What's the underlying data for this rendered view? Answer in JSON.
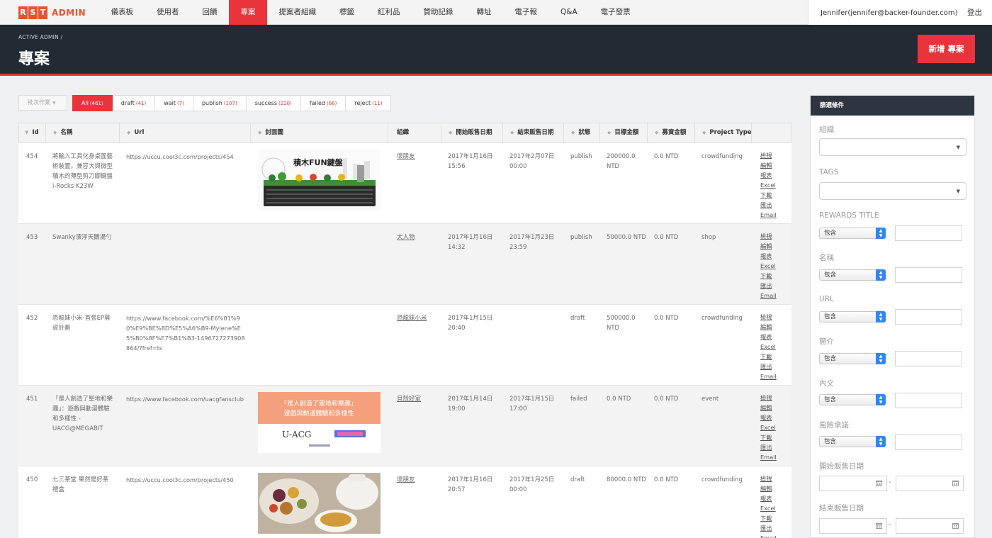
{
  "brand": {
    "letters": [
      "R",
      "S",
      "T"
    ],
    "text": "ADMIN",
    "color": "#e8522f"
  },
  "accent": "#e8343a",
  "nav": [
    {
      "label": "儀表板",
      "active": false
    },
    {
      "label": "使用者",
      "active": false
    },
    {
      "label": "回饋",
      "active": false
    },
    {
      "label": "專案",
      "active": true
    },
    {
      "label": "提案者組織",
      "active": false
    },
    {
      "label": "標籤",
      "active": false
    },
    {
      "label": "紅利品",
      "active": false
    },
    {
      "label": "贊助記錄",
      "active": false
    },
    {
      "label": "轉址",
      "active": false
    },
    {
      "label": "電子報",
      "active": false
    },
    {
      "label": "Q&A",
      "active": false
    },
    {
      "label": "電子發票",
      "active": false
    }
  ],
  "user": {
    "name": "Jennifer(jennifer@backer-founder.com)",
    "logout": "登出"
  },
  "header": {
    "breadcrumb": "ACTIVE ADMIN /",
    "title": "專案",
    "new_button": "新增 專案"
  },
  "batch_actions": {
    "label": "批次作業"
  },
  "scopes": [
    {
      "label": "All",
      "count": "(461)",
      "active": true
    },
    {
      "label": "draft",
      "count": "(41)",
      "active": false
    },
    {
      "label": "wait",
      "count": "(7)",
      "active": false
    },
    {
      "label": "publish",
      "count": "(107)",
      "active": false
    },
    {
      "label": "success",
      "count": "(220)",
      "active": false
    },
    {
      "label": "failed",
      "count": "(66)",
      "active": false
    },
    {
      "label": "reject",
      "count": "(11)",
      "active": false
    }
  ],
  "table": {
    "columns": [
      "Id",
      "名稱",
      "Url",
      "封面圖",
      "組織",
      "開始販售日期",
      "結束販售日期",
      "狀態",
      "目標金額",
      "募資金額",
      "Project Type"
    ],
    "action_labels": [
      "檢視",
      "編輯",
      "報表",
      "Excel",
      "下載",
      "匯出",
      "Email"
    ],
    "rows": [
      {
        "id": "454",
        "name": "將輸入工具化身桌面藝術裝置，兼容大與微型積木的薄型剪刀腳鍵盤 i-Rocks K23W",
        "url": "https://uccu.cool3c.com/projects/454",
        "cover": "keyboard",
        "cover_text": "積木FUN鍵盤",
        "org": "壞朋友",
        "start": "2017年1月16日 15:56",
        "end": "2017年2月07日 00:00",
        "status": "publish",
        "target": "200000.0 NTD",
        "raised": "0.0 NTD",
        "type": "crowdfunding"
      },
      {
        "id": "453",
        "name": "Swanky漂浮天鵝湯勺",
        "url": "",
        "cover": "",
        "cover_text": "",
        "org": "大人物",
        "start": "2017年1月16日 14:32",
        "end": "2017年1月23日 23:59",
        "status": "publish",
        "target": "50000.0 NTD",
        "raised": "0.0 NTD",
        "type": "shop"
      },
      {
        "id": "452",
        "name": "恐龍妹小米-首張EP募資計劃",
        "url": "https://www.facebook.com/%E6%81%90%E9%BE%8D%E5%A6%B9-Mylene%E5%B0%8F%E7%B1%B3-1496727273908864/?fref=ts",
        "cover": "",
        "cover_text": "",
        "org": "恐龍妹小米",
        "start": "2017年1月15日 20:40",
        "end": "",
        "status": "draft",
        "target": "500000.0 NTD",
        "raised": "0.0 NTD",
        "type": "crowdfunding"
      },
      {
        "id": "451",
        "name": "「是人創造了聖地和樂趣」：遊戲與動漫體驗和多樣性 - UACG@MEGABIT",
        "url": "https://www.facebook.com/uacgfansclub",
        "cover": "uacg",
        "cover_text": "「是人創造了聖地和樂趣」遊戲與動漫體驗和多樣性",
        "cover_logo": "U-ACG",
        "org": "貝殼好室",
        "start": "2017年1月14日 19:00",
        "end": "2017年1月15日 17:00",
        "status": "failed",
        "target": "0.0 NTD",
        "raised": "0.0 NTD",
        "type": "event"
      },
      {
        "id": "450",
        "name": "七三茶堂 果然是好茶禮盒",
        "url": "https://uccu.cool3c.com/projects/450",
        "cover": "tea",
        "cover_text": "",
        "org": "壞朋友",
        "start": "2017年1月16日 20:57",
        "end": "2017年1月25日 00:00",
        "status": "draft",
        "target": "80000.0 NTD",
        "raised": "0.0 NTD",
        "type": "crowdfunding"
      }
    ]
  },
  "sidebar": {
    "title": "篩選條件",
    "filters": {
      "org": "組織",
      "tags": "TAGS",
      "rewards_title": "REWARDS TITLE",
      "name": "名稱",
      "url": "URL",
      "intro": "簡介",
      "content": "內文",
      "risk": "風險承諾",
      "start_date": "開始販售日期",
      "end_date": "結束販售日期"
    },
    "contains": "包含",
    "date_sep": "-"
  }
}
